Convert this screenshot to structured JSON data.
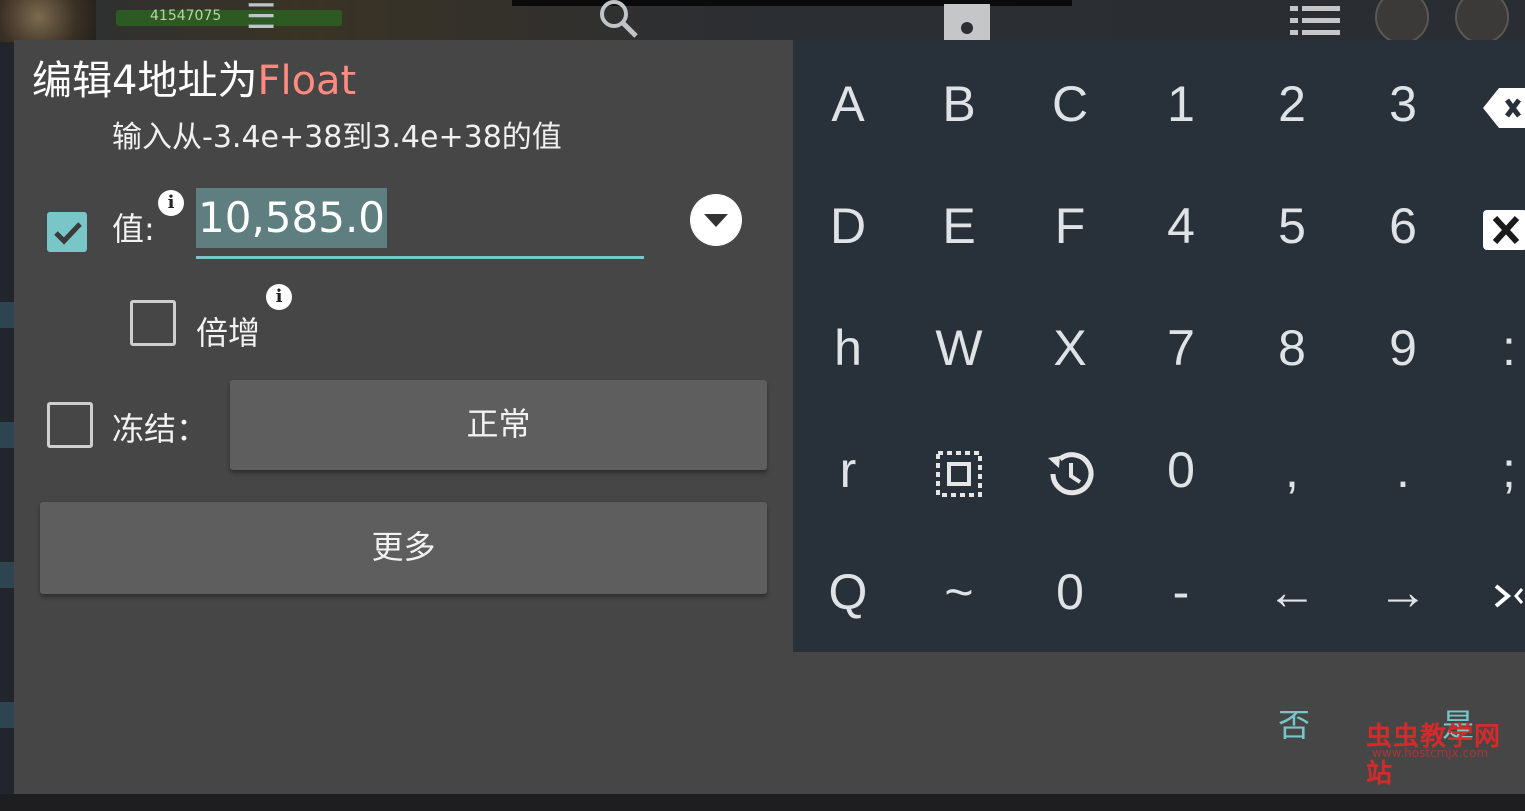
{
  "background": {
    "hp_text": "41547075"
  },
  "dialog": {
    "title_prefix": "编辑4地址为",
    "title_type": "Float",
    "range_hint": "输入从-3.4e+38到3.4e+38的值",
    "value_label": "值:",
    "value": "10,585.0",
    "multiply_label": "倍增",
    "freeze_label": "冻结：",
    "freeze_mode": "正常",
    "more_label": "更多",
    "cancel_label": "否",
    "confirm_label": "是",
    "accent_color": "#78c6c7",
    "type_color": "#ff8a80"
  },
  "keyboard": {
    "rows": [
      [
        "A",
        "B",
        "C",
        "1",
        "2",
        "3"
      ],
      [
        "D",
        "E",
        "F",
        "4",
        "5",
        "6"
      ],
      [
        "h",
        "W",
        "X",
        "7",
        "8",
        "9"
      ],
      [
        "r",
        "select-all-icon",
        "history-icon",
        "0",
        ",",
        "."
      ],
      [
        "Q",
        "~",
        "0",
        "-",
        "←",
        "→"
      ]
    ],
    "edge_keys": [
      "backspace-icon",
      "clear-icon",
      ":",
      ";",
      "hide-keyboard-icon"
    ]
  },
  "watermark": {
    "text": "虫虫教学网站",
    "url": "www.hostcmjx.com"
  }
}
